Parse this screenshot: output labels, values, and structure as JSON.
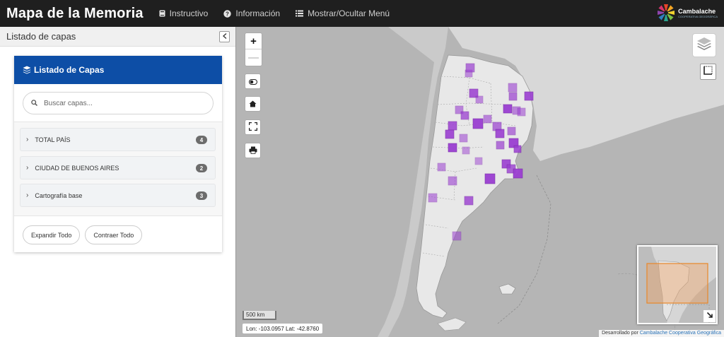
{
  "header": {
    "title": "Mapa de la Memoria",
    "nav": [
      {
        "label": "Instructivo",
        "icon": "book-icon"
      },
      {
        "label": "Información",
        "icon": "question-circle-icon"
      },
      {
        "label": "Mostrar/Ocultar Menú",
        "icon": "list-icon"
      }
    ],
    "logo": {
      "name": "Cambalache",
      "subtitle": "COOPERATIVA GEOGRÁFICA"
    }
  },
  "sidebar": {
    "title": "Listado de capas",
    "panel_title": "Listado de Capas",
    "search_placeholder": "Buscar capas...",
    "groups": [
      {
        "label": "TOTAL PAÍS",
        "count": "4"
      },
      {
        "label": "CIUDAD DE BUENOS AIRES",
        "count": "2"
      },
      {
        "label": "Cartografía base",
        "count": "3"
      }
    ],
    "expand_label": "Expandir Todo",
    "collapse_label": "Contraer Todo"
  },
  "map": {
    "controls": [
      "zoom-in",
      "zoom-out",
      "toggle",
      "home",
      "fullscreen",
      "print"
    ],
    "scale_label": "500 km",
    "coords": "Lon: -103.0957 Lat: -42.8760",
    "attribution_prefix": "Desarrollado por",
    "attribution_link": "Cambalache Cooperativa Geográfica",
    "marker_color": "#9b3fd1",
    "overlay_color": "#f0a060"
  }
}
